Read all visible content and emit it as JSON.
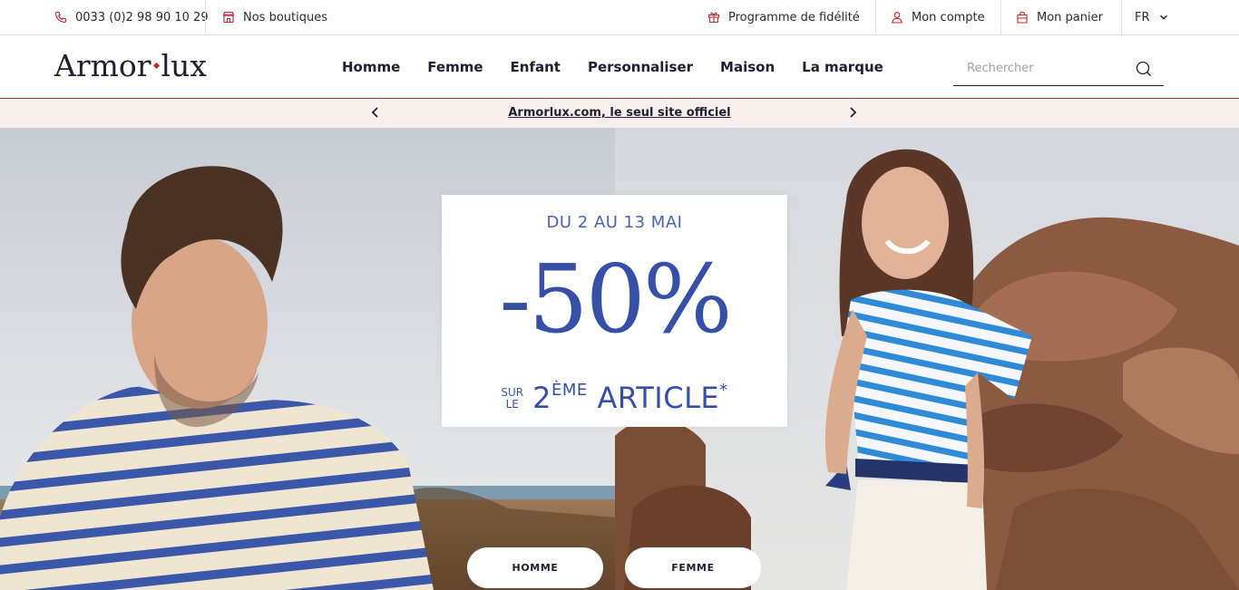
{
  "topbar": {
    "phone": "0033 (0)2 98 90 10 29",
    "stores": "Nos boutiques",
    "loyalty": "Programme de fidélité",
    "account": "Mon compte",
    "cart": "Mon panier",
    "language": "FR"
  },
  "header": {
    "logo_left": "Armor",
    "logo_right": "lux",
    "nav": [
      "Homme",
      "Femme",
      "Enfant",
      "Personnaliser",
      "Maison",
      "La marque"
    ],
    "search_placeholder": "Rechercher"
  },
  "announcement": {
    "text": "Armorlux.com, le seul site officiel"
  },
  "hero": {
    "promo": {
      "dates": "DU 2 AU 13 MAI",
      "discount": "-50%",
      "sub_small_1": "SUR",
      "sub_small_2": "LE",
      "sub_number": "2",
      "sub_ordinal": "ÈME",
      "sub_word": "ARTICLE",
      "sub_asterisk": "*"
    },
    "cta_men": "HOMME",
    "cta_women": "FEMME"
  },
  "colors": {
    "accent_red": "#c0272d",
    "promo_blue": "#3550a6",
    "announce_bg": "#f6efec"
  }
}
